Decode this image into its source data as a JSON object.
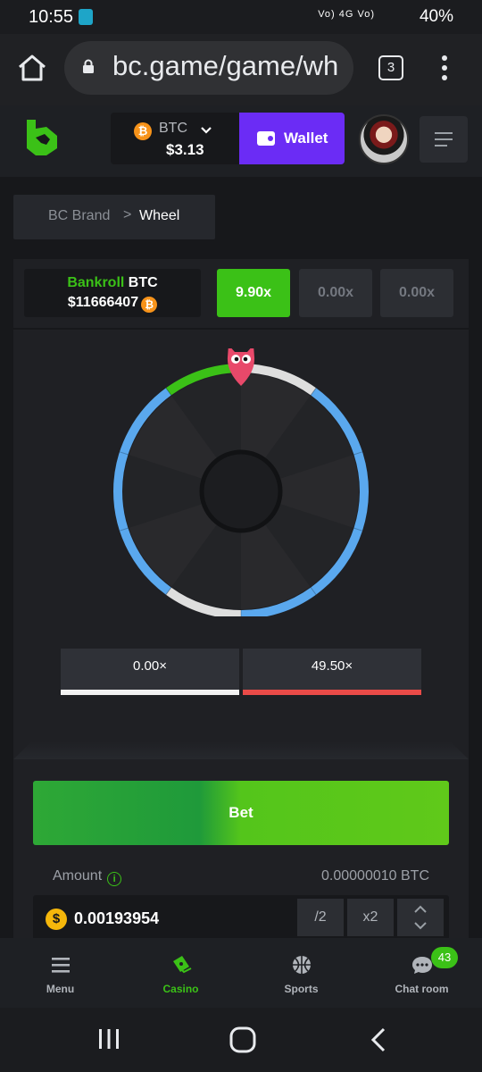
{
  "status_bar": {
    "time": "10:55",
    "signal_text": "Vo) 4G Vo)",
    "battery": "40%"
  },
  "browser": {
    "url": "bc.game/game/wh",
    "tab_count": "3"
  },
  "header": {
    "currency": "BTC",
    "balance": "$3.13",
    "wallet_label": "Wallet",
    "coin_symbol": "₿"
  },
  "breadcrumb": {
    "parent": "BC Brand",
    "separator": ">",
    "current": "Wheel"
  },
  "game": {
    "bankroll_label": "Bankroll",
    "bankroll_currency": "BTC",
    "bankroll_value": "$11666407",
    "multipliers": [
      "9.90x",
      "0.00x",
      "0.00x"
    ],
    "legend": [
      {
        "label": "0.00×",
        "color": "#f2f2f2"
      },
      {
        "label": "49.50×",
        "color": "#ea4b48"
      }
    ],
    "wheel_colors": {
      "green": "#3bc117",
      "blue": "#5aa8ee",
      "white": "#dedede"
    }
  },
  "bet": {
    "button_label": "Bet",
    "amount_label": "Amount",
    "amount_info": "i",
    "min_amount": "0.00000010 BTC",
    "amount_value": "0.00193954",
    "amount_coin": "$",
    "half_label": "/2",
    "double_label": "x2"
  },
  "nav": {
    "items": [
      {
        "label": "Menu",
        "icon": "menu-icon"
      },
      {
        "label": "Casino",
        "icon": "casino-icon"
      },
      {
        "label": "Sports",
        "icon": "sports-icon"
      },
      {
        "label": "Chat room",
        "icon": "chat-icon"
      }
    ],
    "chat_badge": "43"
  },
  "colors": {
    "accent": "#3bc117",
    "wallet": "#6b2cf5",
    "bg": "#17181b"
  }
}
